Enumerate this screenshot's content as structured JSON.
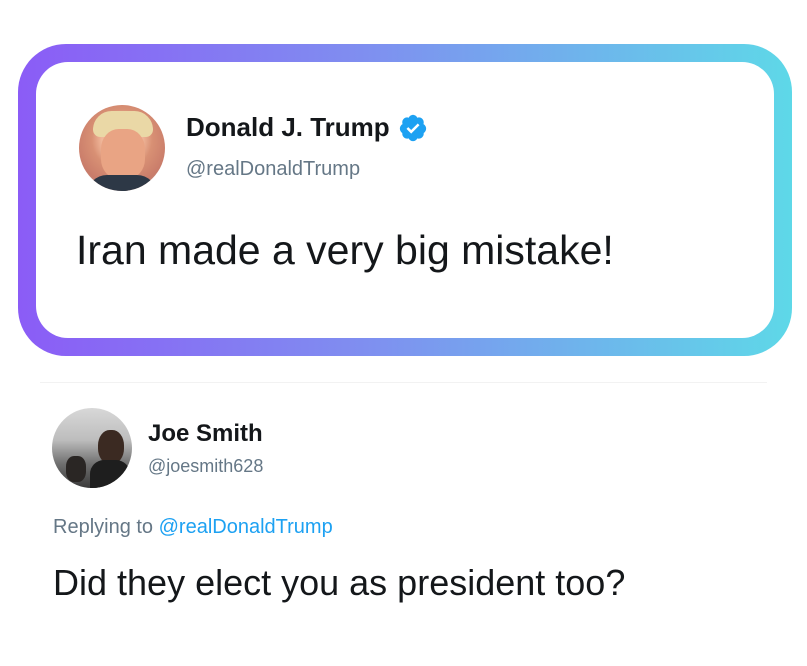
{
  "original_tweet": {
    "display_name": "Donald J. Trump",
    "handle": "@realDonaldTrump",
    "verified": true,
    "verified_color": "#1da1f2",
    "text": "Iran made a very big mistake!"
  },
  "reply_tweet": {
    "display_name": "Joe Smith",
    "handle": "@joesmith628",
    "replying_prefix": "Replying to ",
    "replying_to": "@realDonaldTrump",
    "text": "Did they elect you as president too?"
  },
  "highlight_frame": {
    "gradient_start": "#8b5cf6",
    "gradient_end": "#5ed8e8"
  },
  "colors": {
    "text_primary": "#14171a",
    "text_secondary": "#657786",
    "mention": "#1da1f2"
  }
}
